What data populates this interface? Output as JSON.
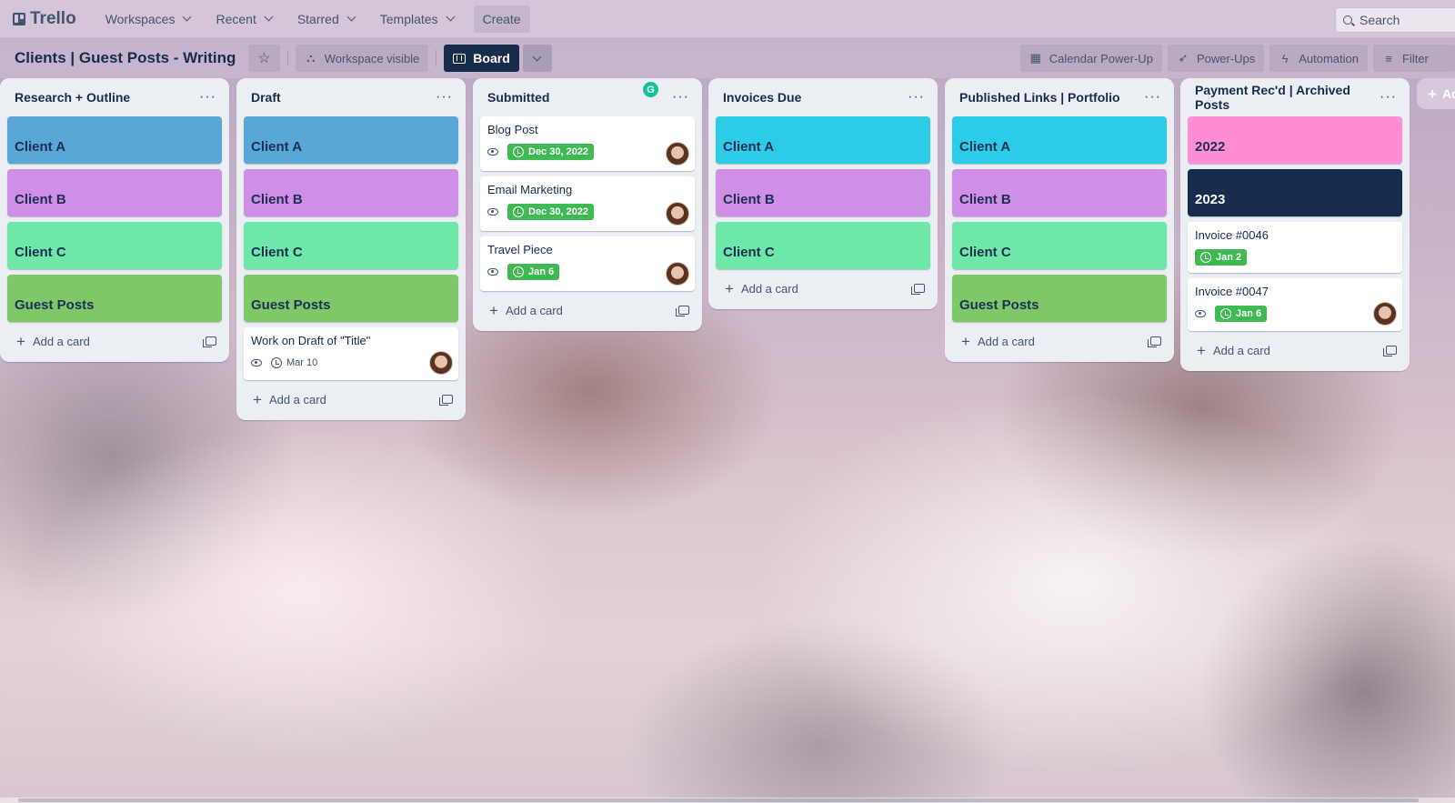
{
  "nav": {
    "logo": "Trello",
    "items": [
      "Workspaces",
      "Recent",
      "Starred",
      "Templates"
    ],
    "create": "Create",
    "search_placeholder": "Search"
  },
  "board": {
    "title": "Clients | Guest Posts - Writing",
    "visibility": "Workspace visible",
    "view": "Board",
    "actions": [
      "Calendar Power-Up",
      "Power-Ups",
      "Automation",
      "Filter"
    ],
    "add_list": "Ad"
  },
  "lists": [
    {
      "title": "Research + Outline",
      "color_cards": [
        {
          "label": "Client A",
          "color": "#5aa6d6"
        },
        {
          "label": "Client B",
          "color": "#cf8fe6"
        },
        {
          "label": "Client C",
          "color": "#6ee8a8"
        },
        {
          "label": "Guest Posts",
          "color": "#7ec86a"
        }
      ],
      "add_card": "Add a card"
    },
    {
      "title": "Draft",
      "color_cards": [
        {
          "label": "Client A",
          "color": "#5aa6d6"
        },
        {
          "label": "Client B",
          "color": "#cf8fe6"
        },
        {
          "label": "Client C",
          "color": "#6ee8a8"
        },
        {
          "label": "Guest Posts",
          "color": "#7ec86a"
        }
      ],
      "cards": [
        {
          "title": "Work on Draft of \"Title\"",
          "due": "Mar 10"
        }
      ],
      "add_card": "Add a card"
    },
    {
      "title": "Submitted",
      "cards": [
        {
          "title": "Blog Post",
          "due": "Dec 30, 2022"
        },
        {
          "title": "Email Marketing",
          "due": "Dec 30, 2022"
        },
        {
          "title": "Travel Piece",
          "due": "Jan 6"
        }
      ],
      "add_card": "Add a card"
    },
    {
      "title": "Invoices Due",
      "color_cards": [
        {
          "label": "Client A",
          "color": "#2ccbe6"
        },
        {
          "label": "Client B",
          "color": "#cf8fe6"
        },
        {
          "label": "Client C",
          "color": "#6ee8a8"
        }
      ],
      "add_card": "Add a card"
    },
    {
      "title": "Published Links | Portfolio",
      "color_cards": [
        {
          "label": "Client A",
          "color": "#2ccbe6"
        },
        {
          "label": "Client B",
          "color": "#cf8fe6"
        },
        {
          "label": "Client C",
          "color": "#6ee8a8"
        },
        {
          "label": "Guest Posts",
          "color": "#7ec86a"
        }
      ],
      "add_card": "Add a card"
    },
    {
      "title": "Payment Rec'd | Archived Posts",
      "color_cards": [
        {
          "label": "2022",
          "color": "#ff8ed4"
        },
        {
          "label": "2023",
          "color": "#172b4d"
        }
      ],
      "cards": [
        {
          "title": "Invoice #0046",
          "due": "Jan 2"
        },
        {
          "title": "Invoice #0047",
          "due": "Jan 6"
        }
      ],
      "add_card": "Add a card"
    }
  ]
}
